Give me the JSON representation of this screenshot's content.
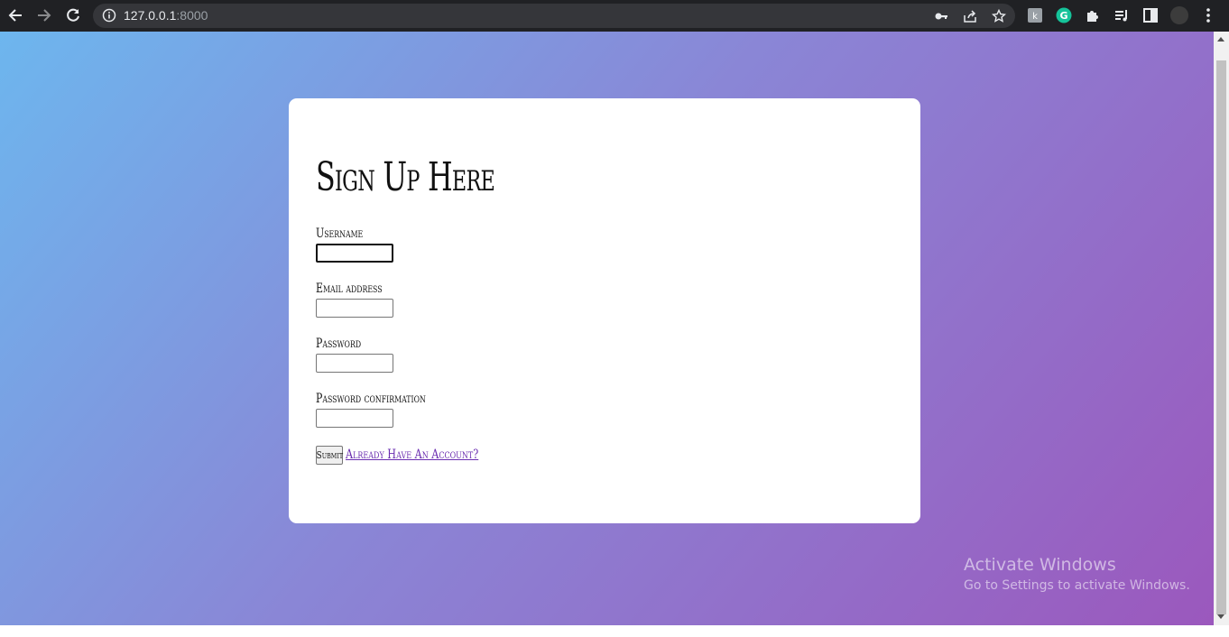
{
  "browser": {
    "url_host": "127.0.0.1",
    "url_port": ":8000",
    "icons": {
      "back": "back-arrow-icon",
      "forward": "forward-arrow-icon",
      "reload": "reload-icon",
      "info": "site-info-icon",
      "key": "password-key-icon",
      "share": "share-icon",
      "bookmark": "star-icon",
      "extensions": [
        "extension-k-icon",
        "grammarly-icon",
        "puzzle-extensions-icon",
        "reading-list-icon",
        "side-panel-icon",
        "profile-avatar-icon",
        "menu-kebab-icon"
      ]
    }
  },
  "form": {
    "title": "Sign Up Here",
    "fields": [
      {
        "label": "Username",
        "value": ""
      },
      {
        "label": "Email address",
        "value": ""
      },
      {
        "label": "Password",
        "value": ""
      },
      {
        "label": "Password confirmation",
        "value": ""
      }
    ],
    "submit_label": "Submit",
    "login_link": "Already Have An Account?"
  },
  "os_watermark": {
    "title": "Activate Windows",
    "subtitle": "Go to Settings to activate Windows."
  },
  "colors": {
    "gradient_start": "#6db6ee",
    "gradient_end": "#9b58bd",
    "link": "#6a2db0"
  }
}
